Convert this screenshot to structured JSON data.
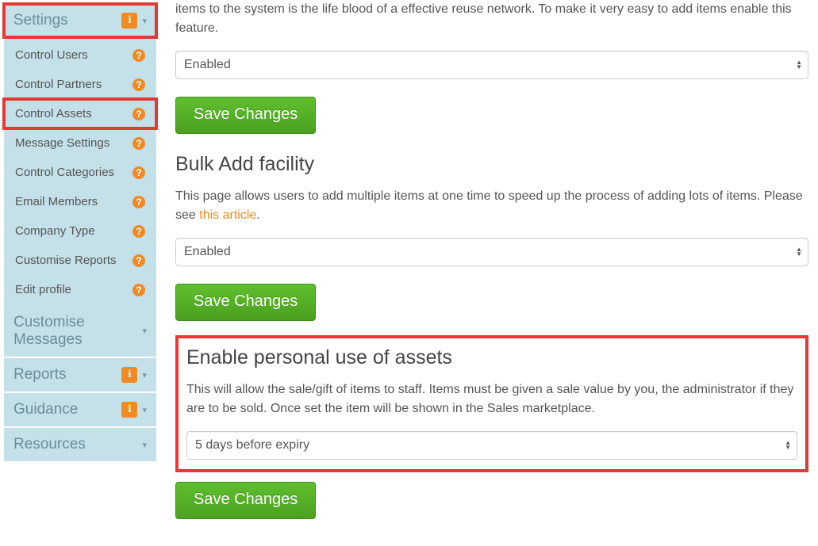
{
  "sidebar": {
    "sections": [
      {
        "label": "Settings",
        "has_info": true,
        "items": [
          {
            "label": "Control Users"
          },
          {
            "label": "Control Partners"
          },
          {
            "label": "Control Assets"
          },
          {
            "label": "Message Settings"
          },
          {
            "label": "Control Categories"
          },
          {
            "label": "Email Members"
          },
          {
            "label": "Company Type"
          },
          {
            "label": "Customise Reports"
          },
          {
            "label": "Edit profile"
          }
        ]
      },
      {
        "label": "Customise Messages",
        "has_info": false
      },
      {
        "label": "Reports",
        "has_info": true
      },
      {
        "label": "Guidance",
        "has_info": true
      },
      {
        "label": "Resources",
        "has_info": false
      }
    ]
  },
  "main": {
    "intro_fragment": "items to the system is the life blood of a effective reuse network. To make it very easy to add items enable this feature.",
    "select1": "Enabled",
    "save_label": "Save Changes",
    "bulk_title": "Bulk Add facility",
    "bulk_desc_prefix": "This page allows users to add multiple items at one time to speed up the process of adding lots of items. Please see ",
    "bulk_link": "this article",
    "bulk_desc_suffix": ".",
    "select2": "Enabled",
    "personal_title": "Enable personal use of assets",
    "personal_desc": "This will allow the sale/gift of items to staff. Items must be given a sale value by you, the administrator if they are to be sold. Once set the item will be shown in the Sales marketplace.",
    "select3": "5 days before expiry"
  }
}
